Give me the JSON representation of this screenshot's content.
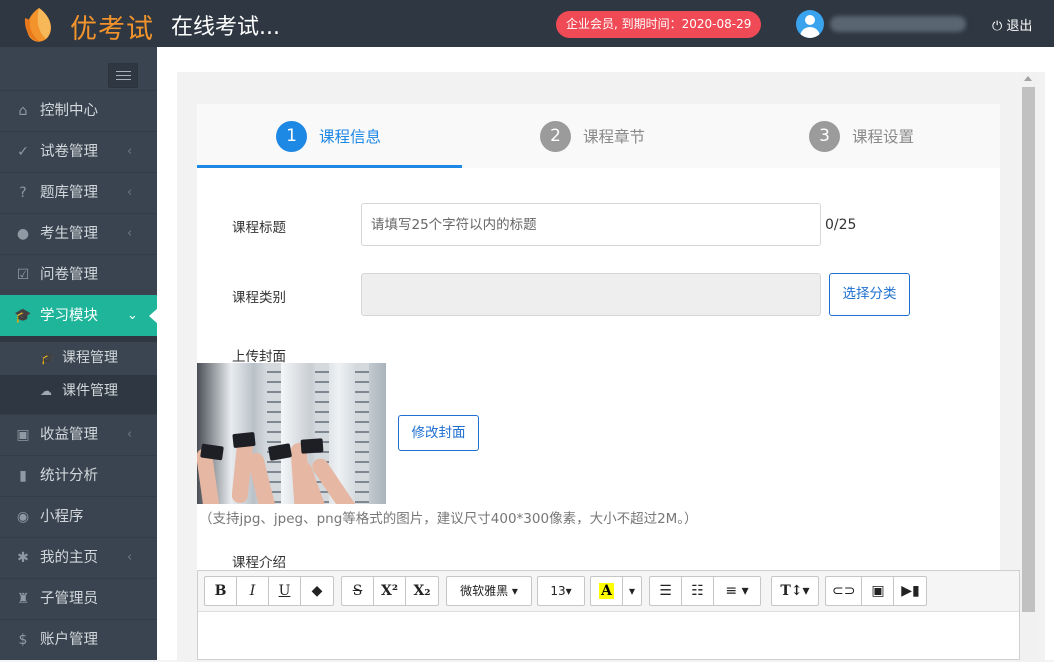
{
  "header": {
    "brand": "优考试",
    "app_title": "在线考试...",
    "member_badge": "企业会员, 到期时间：2020-08-29",
    "logout_label": "退出"
  },
  "sidebar": {
    "items": [
      {
        "label": "控制中心",
        "icon": "home-icon"
      },
      {
        "label": "试卷管理",
        "icon": "check-circle-icon"
      },
      {
        "label": "题库管理",
        "icon": "question-circle-icon"
      },
      {
        "label": "考生管理",
        "icon": "user-icon"
      },
      {
        "label": "问卷管理",
        "icon": "check-square-icon"
      },
      {
        "label": "学习模块",
        "icon": "graduation-cap-icon",
        "active": true
      },
      {
        "label": "收益管理",
        "icon": "money-icon"
      },
      {
        "label": "统计分析",
        "icon": "bar-chart-icon"
      },
      {
        "label": "小程序",
        "icon": "wechat-icon"
      },
      {
        "label": "我的主页",
        "icon": "home-page-icon"
      },
      {
        "label": "子管理员",
        "icon": "admin-icon"
      },
      {
        "label": "账户管理",
        "icon": "dollar-icon"
      }
    ],
    "sub_items": [
      {
        "label": "课程管理",
        "icon": "graduation-cap-icon"
      },
      {
        "label": "课件管理",
        "icon": "cloud-upload-icon"
      }
    ]
  },
  "steps": [
    {
      "num": "1",
      "label": "课程信息"
    },
    {
      "num": "2",
      "label": "课程章节"
    },
    {
      "num": "3",
      "label": "课程设置"
    }
  ],
  "form": {
    "title_label": "课程标题",
    "title_placeholder": "请填写25个字符以内的标题",
    "title_counter": "0/25",
    "category_label": "课程类别",
    "category_button": "选择分类",
    "cover_label": "上传封面",
    "cover_button": "修改封面",
    "cover_hint": "（支持jpg、jpeg、png等格式的图片，建议尺寸400*300像素，大小不超过2M。）",
    "intro_label": "课程介绍"
  },
  "toolbar": {
    "font": "微软雅黑",
    "size": "13"
  },
  "colors": {
    "accent": "#1e88e5",
    "active_nav": "#1fb59a",
    "badge": "#ef4a55",
    "brand": "#f2932b",
    "topbar": "#2e3742",
    "sidebar": "#3a4450"
  }
}
